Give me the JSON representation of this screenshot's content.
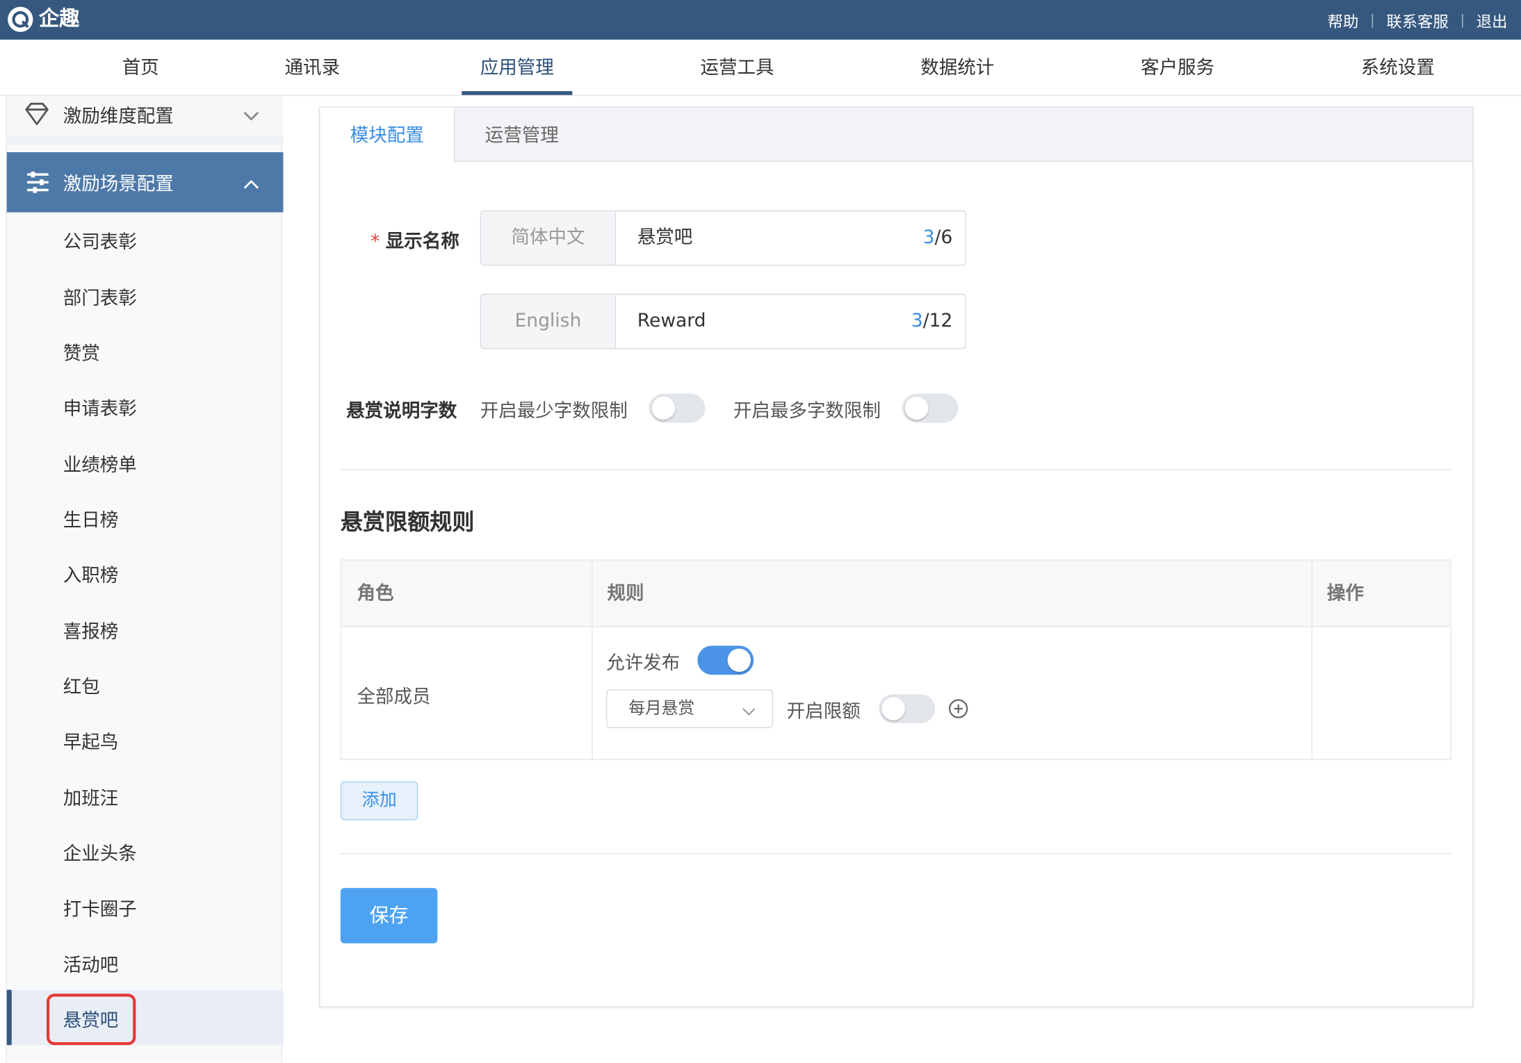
{
  "app": {
    "brand": "企趣",
    "logo_icon": "logo-icon"
  },
  "top_links": [
    "帮助",
    "联系客服",
    "退出"
  ],
  "nav": {
    "items": [
      "首页",
      "通讯录",
      "应用管理",
      "运营工具",
      "数据统计",
      "客户服务",
      "系统设置"
    ],
    "active": "应用管理"
  },
  "sidebar": {
    "collapsed_group": {
      "label": "激励维度配置",
      "icon": "diamond-icon"
    },
    "open_group": {
      "label": "激励场景配置",
      "icon": "sliders-icon"
    },
    "items": [
      "公司表彰",
      "部门表彰",
      "赞赏",
      "申请表彰",
      "业绩榜单",
      "生日榜",
      "入职榜",
      "喜报榜",
      "红包",
      "早起鸟",
      "加班汪",
      "企业头条",
      "打卡圈子",
      "活动吧",
      "悬赏吧"
    ],
    "active": "悬赏吧"
  },
  "tabs": [
    "模块配置",
    "运营管理"
  ],
  "form": {
    "display_name_label": "显示名称",
    "zh": {
      "prefix": "简体中文",
      "value": "悬赏吧",
      "count_current": "3",
      "count_max": "/6"
    },
    "en": {
      "prefix": "English",
      "value": "Reward",
      "count_current": "3",
      "count_max": "/12"
    },
    "desc_label": "悬赏说明字数",
    "min_limit_label": "开启最少字数限制",
    "max_limit_label": "开启最多字数限制",
    "min_limit_on": false,
    "max_limit_on": false
  },
  "limit_rules": {
    "title": "悬赏限额规则",
    "columns": [
      "角色",
      "规则",
      "操作"
    ],
    "rows": [
      {
        "role": "全部成员",
        "allow_publish_label": "允许发布",
        "allow_publish_on": true,
        "period_value": "每月悬赏",
        "enable_limit_label": "开启限额",
        "enable_limit_on": false
      }
    ],
    "add_button": "添加"
  },
  "save_button": "保存",
  "colors": {
    "header": "#36587f",
    "accent": "#3b8ee4",
    "sidebar_active": "#4d79a9",
    "save": "#4da3f2",
    "highlight_box": "#e23a37"
  }
}
